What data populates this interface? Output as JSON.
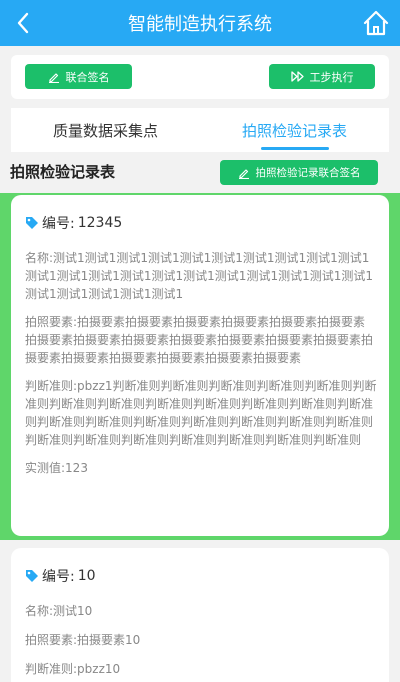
{
  "header": {
    "title": "智能制造执行系统"
  },
  "actions": {
    "sign_label": "联合签名",
    "step_label": "工步执行"
  },
  "tabs": [
    {
      "label": "质量数据采集点",
      "active": false
    },
    {
      "label": "拍照检验记录表",
      "active": true
    }
  ],
  "section": {
    "title": "拍照检验记录表",
    "joint_sign_label": "拍照检验记录联合签名"
  },
  "records": [
    {
      "code_label": "编号:",
      "code_value": "12345",
      "name_label": "名称:",
      "name_value": "测试1测试1测试1测试1测试1测试1测试1测试1测试1测试1测试1测试1测试1测试1测试1测试1测试1测试1测试1测试1测试1测试1测试1测试1测试1测试1",
      "photo_label": "拍照要素:",
      "photo_value": "拍摄要素拍摄要素拍摄要素拍摄要素拍摄要素拍摄要素拍摄要素拍摄要素拍摄要素拍摄要素拍摄要素拍摄要素拍摄要素拍摄要素拍摄要素拍摄要素拍摄要素拍摄要素拍摄要素",
      "rule_label": "判断准则:",
      "rule_value": "pbzz1判断准则判断准则判断准则判断准则判断准则判断准则判断准则判断准则判断准则判断准则判断准则判断准则判断准则判断准则判断准则判断准则判断准则判断准则判断准则判断准则判断准则判断准则判断准则判断准则判断准则判断准则判断准则",
      "measure_label": "实测值:",
      "measure_value": "123",
      "highlighted": true
    },
    {
      "code_label": "编号:",
      "code_value": "10",
      "name_label": "名称:",
      "name_value": "测试10",
      "photo_label": "拍照要素:",
      "photo_value": "拍摄要素10",
      "rule_label": "判断准则:",
      "rule_value": "pbzz10",
      "highlighted": false
    }
  ],
  "colors": {
    "primary": "#27a9f4",
    "green": "#1cbf6a",
    "highlight": "#5fd66a"
  }
}
